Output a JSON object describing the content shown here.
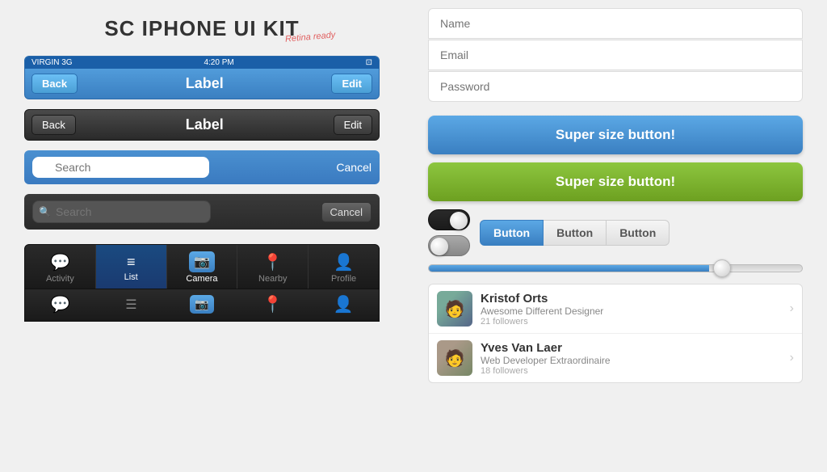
{
  "title": "SC IPHONE UI KIT",
  "retina_label": "Retina ready",
  "status_bar": {
    "signal": "VIRGIN  3G",
    "time": "4:20 PM",
    "battery": "▪▪▪▪"
  },
  "blue_navbar": {
    "back_label": "Back",
    "title": "Label",
    "edit_label": "Edit"
  },
  "dark_navbar": {
    "back_label": "Back",
    "title": "Label",
    "edit_label": "Edit"
  },
  "search_blue": {
    "placeholder": "Search",
    "cancel_label": "Cancel"
  },
  "search_dark": {
    "placeholder": "Search",
    "cancel_label": "Cancel"
  },
  "tab_bar": {
    "items": [
      {
        "label": "Activity",
        "icon": "💬",
        "active": false
      },
      {
        "label": "List",
        "icon": "≡",
        "active": true
      },
      {
        "label": "Camera",
        "icon": "📷",
        "active": false,
        "highlight": true
      },
      {
        "label": "Nearby",
        "icon": "📍",
        "active": false
      },
      {
        "label": "Profile",
        "icon": "👤",
        "active": false
      }
    ]
  },
  "form": {
    "name_placeholder": "Name",
    "email_placeholder": "Email",
    "password_placeholder": "Password"
  },
  "buttons": {
    "super_blue_label": "Super size button!",
    "super_green_label": "Super size button!",
    "seg_labels": [
      "Button",
      "Button",
      "Button"
    ]
  },
  "progress": {
    "value": 75
  },
  "users": [
    {
      "name": "Kristof Orts",
      "desc": "Awesome Different Designer",
      "followers": "21 followers",
      "avatar_color": "#7a9988"
    },
    {
      "name": "Yves Van Laer",
      "desc": "Web Developer Extraordinaire",
      "followers": "18 followers",
      "avatar_color": "#a98877"
    }
  ]
}
